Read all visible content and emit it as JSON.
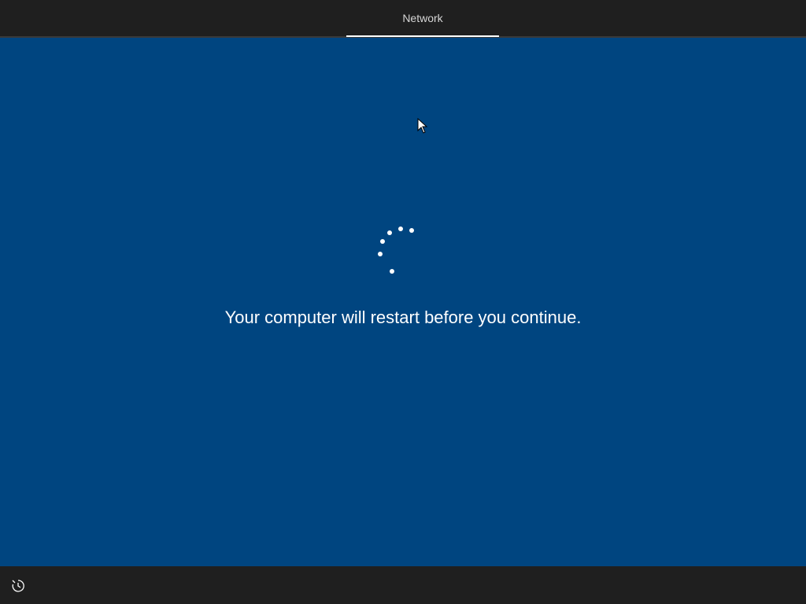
{
  "header": {
    "tab_label": "Network"
  },
  "main": {
    "status_message": "Your computer will restart before you continue."
  },
  "icons": {
    "spinner": "loading-spinner-icon",
    "cursor": "mouse-pointer-icon",
    "ease_of_access": "ease-of-access-icon"
  },
  "colors": {
    "background": "#004580",
    "bars": "#1f1f1f",
    "text": "#ffffff"
  }
}
